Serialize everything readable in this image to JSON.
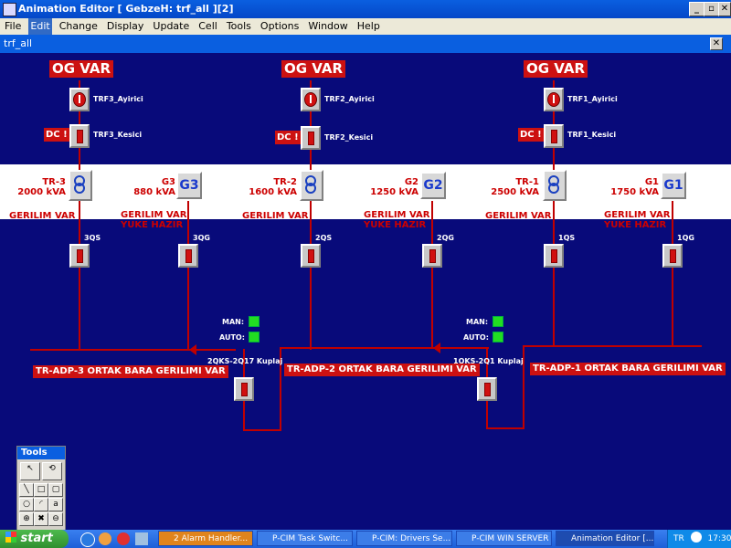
{
  "window": {
    "title": "Animation Editor [ GebzeH: trf_all  ][2]",
    "doc_title": "trf_all"
  },
  "menu": [
    "File",
    "Edit",
    "Change",
    "Display",
    "Update",
    "Cell",
    "Tools",
    "Options",
    "Window",
    "Help"
  ],
  "window_buttons": {
    "min": "_",
    "max": "▫",
    "close": "✕"
  },
  "feeders": [
    {
      "og": "OG VAR",
      "ayirici": "TRF3_Ayirici",
      "kesici": "TRF3_Kesici",
      "dc": "DC !",
      "tr_name": "TR-3",
      "tr_kva": "2000 kVA",
      "tr_status": "GERILIM VAR",
      "qs": "3QS",
      "g_name": "G3",
      "g_kva": "880 kVA",
      "g_label": "G3",
      "g_status1": "GERILIM VAR",
      "g_status2": "YUKE HAZIR",
      "qg": "3QG"
    },
    {
      "og": "OG VAR",
      "ayirici": "TRF2_Ayirici",
      "kesici": "TRF2_Kesici",
      "dc": "DC !",
      "tr_name": "TR-2",
      "tr_kva": "1600 kVA",
      "tr_status": "GERILIM VAR",
      "qs": "2QS",
      "g_name": "G2",
      "g_kva": "1250 kVA",
      "g_label": "G2",
      "g_status1": "GERILIM VAR",
      "g_status2": "YUKE HAZIR",
      "qg": "2QG"
    },
    {
      "og": "OG VAR",
      "ayirici": "TRF1_Ayirici",
      "kesici": "TRF1_Kesici",
      "dc": "DC !",
      "tr_name": "TR-1",
      "tr_kva": "2500 kVA",
      "tr_status": "GERILIM VAR",
      "qs": "1QS",
      "g_name": "G1",
      "g_kva": "1750 kVA",
      "g_label": "G1",
      "g_status1": "GERILIM VAR",
      "g_status2": "YUKE HAZIR",
      "qg": "1QG"
    }
  ],
  "couplers": [
    {
      "man": "MAN:",
      "auto": "AUTO:",
      "name": "2QKS-2Q17 Kuplaj"
    },
    {
      "man": "MAN:",
      "auto": "AUTO:",
      "name": "1QKS-2Q1 Kuplaj"
    }
  ],
  "buses": [
    "TR-ADP-3 ORTAK BARA GERILIMI VAR",
    "TR-ADP-2 ORTAK BARA GERILIMI VAR",
    "TR-ADP-1 ORTAK BARA GERILIMI VAR"
  ],
  "tools": {
    "title": "Tools"
  },
  "taskbar": {
    "start": "start",
    "tasks": [
      "2 Alarm Handler...",
      "P-CIM Task Switc...",
      "P-CIM: Drivers Se...",
      "P-CIM WIN SERVER",
      "Animation Editor [..."
    ],
    "lang": "TR",
    "clock": "17:30"
  },
  "colors": {
    "canvas": "#080a7a",
    "alarm_red": "#cc1111",
    "led_green": "#22dd22"
  }
}
